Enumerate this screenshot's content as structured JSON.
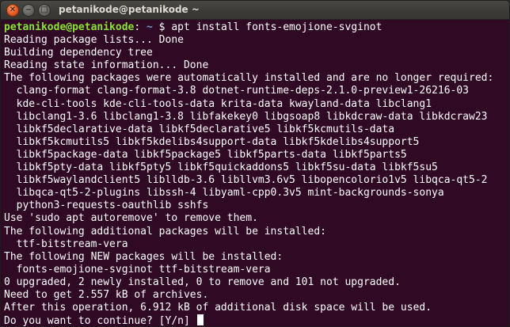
{
  "window": {
    "title": "petanikode@petanikode ~",
    "close_glyph": "✕",
    "min_glyph": "−",
    "max_glyph": "□"
  },
  "prompt": {
    "user_host": "petanikode@petanikode",
    "path": " ~",
    "symbol": " $ ",
    "command": "apt install fonts-emojione-svginot"
  },
  "output": [
    "Reading package lists... Done",
    "Building dependency tree",
    "Reading state information... Done",
    "The following packages were automatically installed and are no longer required:",
    "  clang-format clang-format-3.8 dotnet-runtime-deps-2.1.0-preview1-26216-03",
    "  kde-cli-tools kde-cli-tools-data krita-data kwayland-data libclang1",
    "  libclang1-3.6 libclang1-3.8 libfakekey0 libgsoap8 libkdcraw-data libkdcraw23",
    "  libkf5declarative-data libkf5declarative5 libkf5kcmutils-data",
    "  libkf5kcmutils5 libkf5kdelibs4support-data libkf5kdelibs4support5",
    "  libkf5package-data libkf5package5 libkf5parts-data libkf5parts5",
    "  libkf5pty-data libkf5pty5 libkf5quickaddons5 libkf5su-data libkf5su5",
    "  libkf5waylandclient5 liblldb-3.6 libllvm3.6v5 libopencolorio1v5 libqca-qt5-2",
    "  libqca-qt5-2-plugins libssh-4 libyaml-cpp0.3v5 mint-backgrounds-sonya",
    "  python3-requests-oauthlib sshfs",
    "Use 'sudo apt autoremove' to remove them.",
    "The following additional packages will be installed:",
    "  ttf-bitstream-vera",
    "The following NEW packages will be installed:",
    "  fonts-emojione-svginot ttf-bitstream-vera",
    "0 upgraded, 2 newly installed, 0 to remove and 101 not upgraded.",
    "Need to get 2.557 kB of archives.",
    "After this operation, 6.912 kB of additional disk space will be used."
  ],
  "final_prompt": "Do you want to continue? [Y/n] ",
  "colors": {
    "background": "#300a24",
    "text": "#ffffff",
    "user_host": "#8ae234",
    "path": "#729fcf"
  }
}
